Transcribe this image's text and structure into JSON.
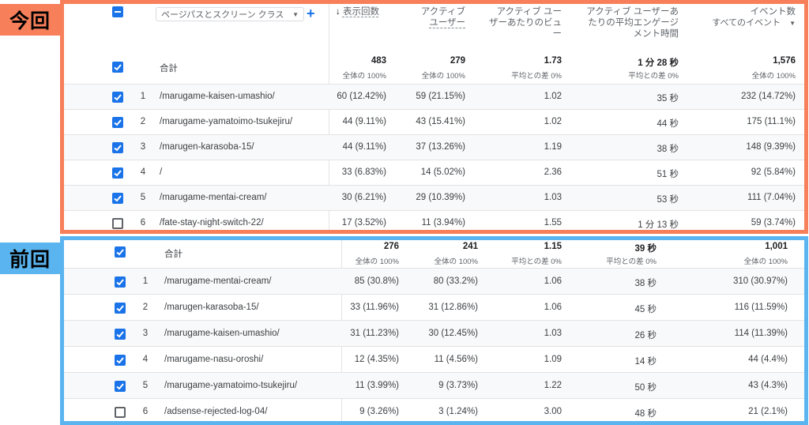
{
  "labels": {
    "current": "今回",
    "previous": "前回"
  },
  "header": {
    "dimension_select": "ページパスとスクリーン クラス",
    "add_label": "+",
    "col_views": "表示回数",
    "col_users_l1": "アクティブ",
    "col_users_l2": "ユーザー",
    "col_vpu_l1": "アクティブ ユー",
    "col_vpu_l2": "ザーあたりのビュ",
    "col_vpu_l3": "ー",
    "col_eng_l1": "アクティブ ユーザーあ",
    "col_eng_l2": "たりの平均エンゲージ",
    "col_eng_l3": "メント時間",
    "col_events_l1": "イベント数",
    "col_events_l2": "すべてのイベント"
  },
  "current": {
    "total_label": "合計",
    "totals": {
      "views": "483",
      "views_sub": "全体の 100%",
      "users": "279",
      "users_sub": "全体の 100%",
      "vpu": "1.73",
      "vpu_sub": "平均との差 0%",
      "eng": "1 分 28 秒",
      "eng_sub": "平均との差 0%",
      "events": "1,576",
      "events_sub": "全体の 100%"
    },
    "rows": [
      {
        "idx": "1",
        "path": "/marugame-kaisen-umashio/",
        "views": "60 (12.42%)",
        "users": "59 (21.15%)",
        "vpu": "1.02",
        "eng": "35 秒",
        "events": "232 (14.72%)"
      },
      {
        "idx": "2",
        "path": "/marugame-yamatoimo-tsukejiru/",
        "views": "44 (9.11%)",
        "users": "43 (15.41%)",
        "vpu": "1.02",
        "eng": "44 秒",
        "events": "175 (11.1%)"
      },
      {
        "idx": "3",
        "path": "/marugen-karasoba-15/",
        "views": "44 (9.11%)",
        "users": "37 (13.26%)",
        "vpu": "1.19",
        "eng": "38 秒",
        "events": "148 (9.39%)"
      },
      {
        "idx": "4",
        "path": "/",
        "views": "33 (6.83%)",
        "users": "14 (5.02%)",
        "vpu": "2.36",
        "eng": "51 秒",
        "events": "92 (5.84%)"
      },
      {
        "idx": "5",
        "path": "/marugame-mentai-cream/",
        "views": "30 (6.21%)",
        "users": "29 (10.39%)",
        "vpu": "1.03",
        "eng": "53 秒",
        "events": "111 (7.04%)"
      },
      {
        "idx": "6",
        "path": "/fate-stay-night-switch-22/",
        "views": "17 (3.52%)",
        "users": "11 (3.94%)",
        "vpu": "1.55",
        "eng": "1 分 13 秒",
        "events": "59 (3.74%)"
      }
    ]
  },
  "previous": {
    "total_label": "合計",
    "totals": {
      "views": "276",
      "views_sub": "全体の 100%",
      "users": "241",
      "users_sub": "全体の 100%",
      "vpu": "1.15",
      "vpu_sub": "平均との差 0%",
      "eng": "39 秒",
      "eng_sub": "平均との差 0%",
      "events": "1,001",
      "events_sub": "全体の 100%"
    },
    "rows": [
      {
        "idx": "1",
        "path": "/marugame-mentai-cream/",
        "views": "85 (30.8%)",
        "users": "80 (33.2%)",
        "vpu": "1.06",
        "eng": "38 秒",
        "events": "310 (30.97%)"
      },
      {
        "idx": "2",
        "path": "/marugen-karasoba-15/",
        "views": "33 (11.96%)",
        "users": "31 (12.86%)",
        "vpu": "1.06",
        "eng": "45 秒",
        "events": "116 (11.59%)"
      },
      {
        "idx": "3",
        "path": "/marugame-kaisen-umashio/",
        "views": "31 (11.23%)",
        "users": "30 (12.45%)",
        "vpu": "1.03",
        "eng": "26 秒",
        "events": "114 (11.39%)"
      },
      {
        "idx": "4",
        "path": "/marugame-nasu-oroshi/",
        "views": "12 (4.35%)",
        "users": "11 (4.56%)",
        "vpu": "1.09",
        "eng": "14 秒",
        "events": "44 (4.4%)"
      },
      {
        "idx": "5",
        "path": "/marugame-yamatoimo-tsukejiru/",
        "views": "11 (3.99%)",
        "users": "9 (3.73%)",
        "vpu": "1.22",
        "eng": "50 秒",
        "events": "43 (4.3%)"
      },
      {
        "idx": "6",
        "path": "/adsense-rejected-log-04/",
        "views": "9 (3.26%)",
        "users": "3 (1.24%)",
        "vpu": "3.00",
        "eng": "48 秒",
        "events": "21 (2.1%)"
      }
    ]
  },
  "colors": {
    "current_frame": "#f77f5a",
    "previous_frame": "#5ab4ef",
    "checkbox": "#1a73e8"
  }
}
